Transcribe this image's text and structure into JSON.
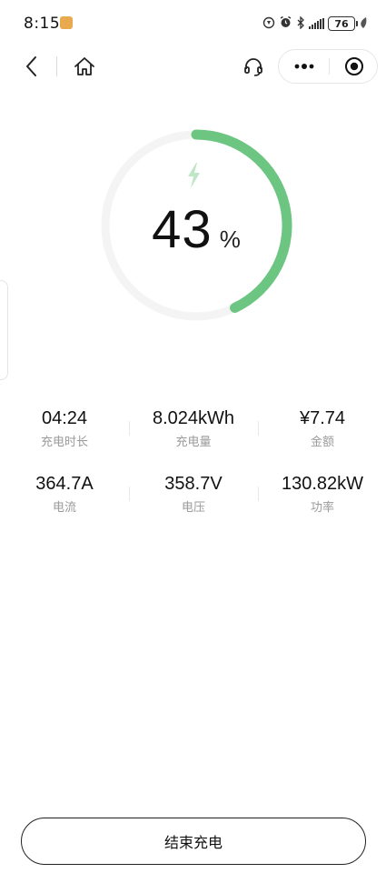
{
  "status_bar": {
    "time": "8:15",
    "battery": "76",
    "icons": [
      "app-notification-icon",
      "data-saver-icon",
      "alarm-icon",
      "bluetooth-icon",
      "signal-icon",
      "battery-icon",
      "leaf-icon"
    ]
  },
  "nav": {
    "icons": [
      "back-icon",
      "home-icon",
      "headset-icon",
      "more-icon",
      "close-target-icon"
    ]
  },
  "charge": {
    "percent_value": "43",
    "percent_unit": "%",
    "progress": 0.43,
    "colors": {
      "arc": "#6cc581",
      "track": "#f4f4f4",
      "bolt": "#bfe6c8"
    }
  },
  "stats": {
    "rows": [
      [
        {
          "value": "04:24",
          "label": "充电时长"
        },
        {
          "value": "8.024kWh",
          "label": "充电量"
        },
        {
          "value": "¥7.74",
          "label": "金额"
        }
      ],
      [
        {
          "value": "364.7A",
          "label": "电流"
        },
        {
          "value": "358.7V",
          "label": "电压"
        },
        {
          "value": "130.82kW",
          "label": "功率"
        }
      ]
    ]
  },
  "actions": {
    "end_label": "结束充电"
  }
}
